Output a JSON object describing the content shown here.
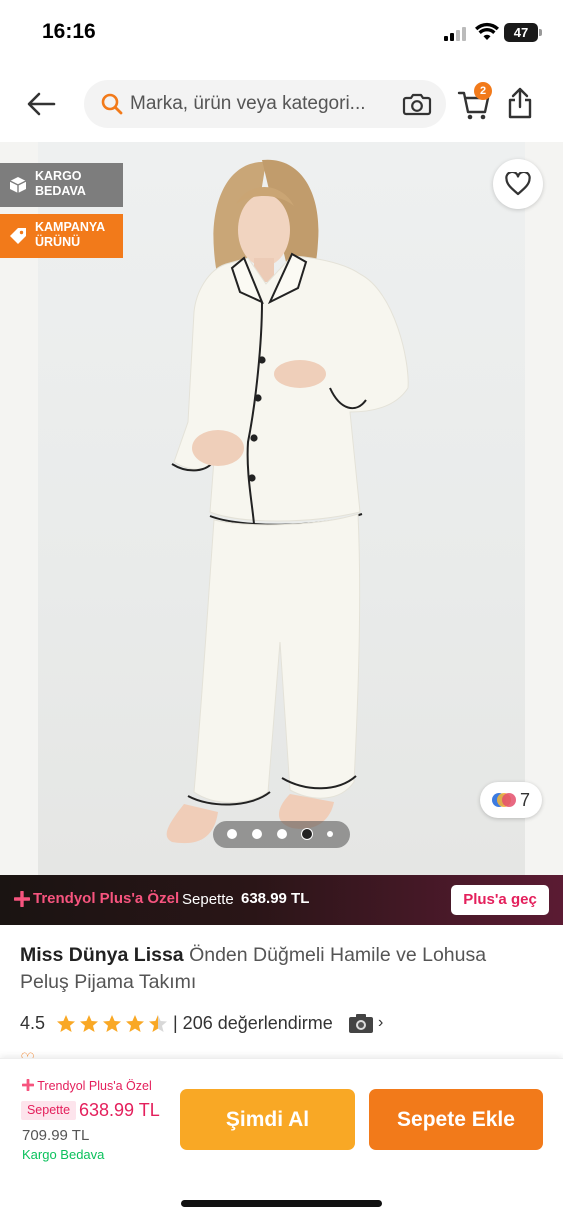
{
  "status_bar": {
    "time": "16:16",
    "battery": "47"
  },
  "header": {
    "search_placeholder": "Marka, ürün veya kategori...",
    "cart_count": "2",
    "icons": [
      "back-arrow-icon",
      "search-icon",
      "camera-icon",
      "cart-icon",
      "share-icon"
    ]
  },
  "gallery": {
    "badges": [
      {
        "label_line1": "KARGO",
        "label_line2": "BEDAVA",
        "icon": "box-icon",
        "color": "#7d7d7d"
      },
      {
        "label_line1": "KAMPANYA",
        "label_line2": "ÜRÜNÜ",
        "icon": "tag-icon",
        "color": "#f27a1a"
      }
    ],
    "color_count": "7",
    "page_count": 5,
    "active_page": 4
  },
  "plus_banner": {
    "title": "Trendyol Plus'a Özel",
    "sepette": "Sepette",
    "price": "638.99 TL",
    "button": "Plus'a geç"
  },
  "product": {
    "brand": "Miss Dünya Lissa",
    "name": "Önden Düğmeli Hamile ve Lohusa Peluş Pijama Takımı",
    "rating": "4.5",
    "rating_stars": 4.5,
    "reviews": "| 206 değerlendirme"
  },
  "bottom_bar": {
    "plus_label": "Trendyol Plus'a Özel",
    "sepette": "Sepette",
    "plus_price": "638.99 TL",
    "old_price": "709.99 TL",
    "kargo": "Kargo Bedava",
    "buy_now": "Şimdi Al",
    "add_to_cart": "Sepete Ekle"
  },
  "colors": {
    "accent": "#f27a1a",
    "plus_pink": "#e4205c",
    "buy_yellow": "#f9a825",
    "kargo_green": "#0bc15c"
  }
}
